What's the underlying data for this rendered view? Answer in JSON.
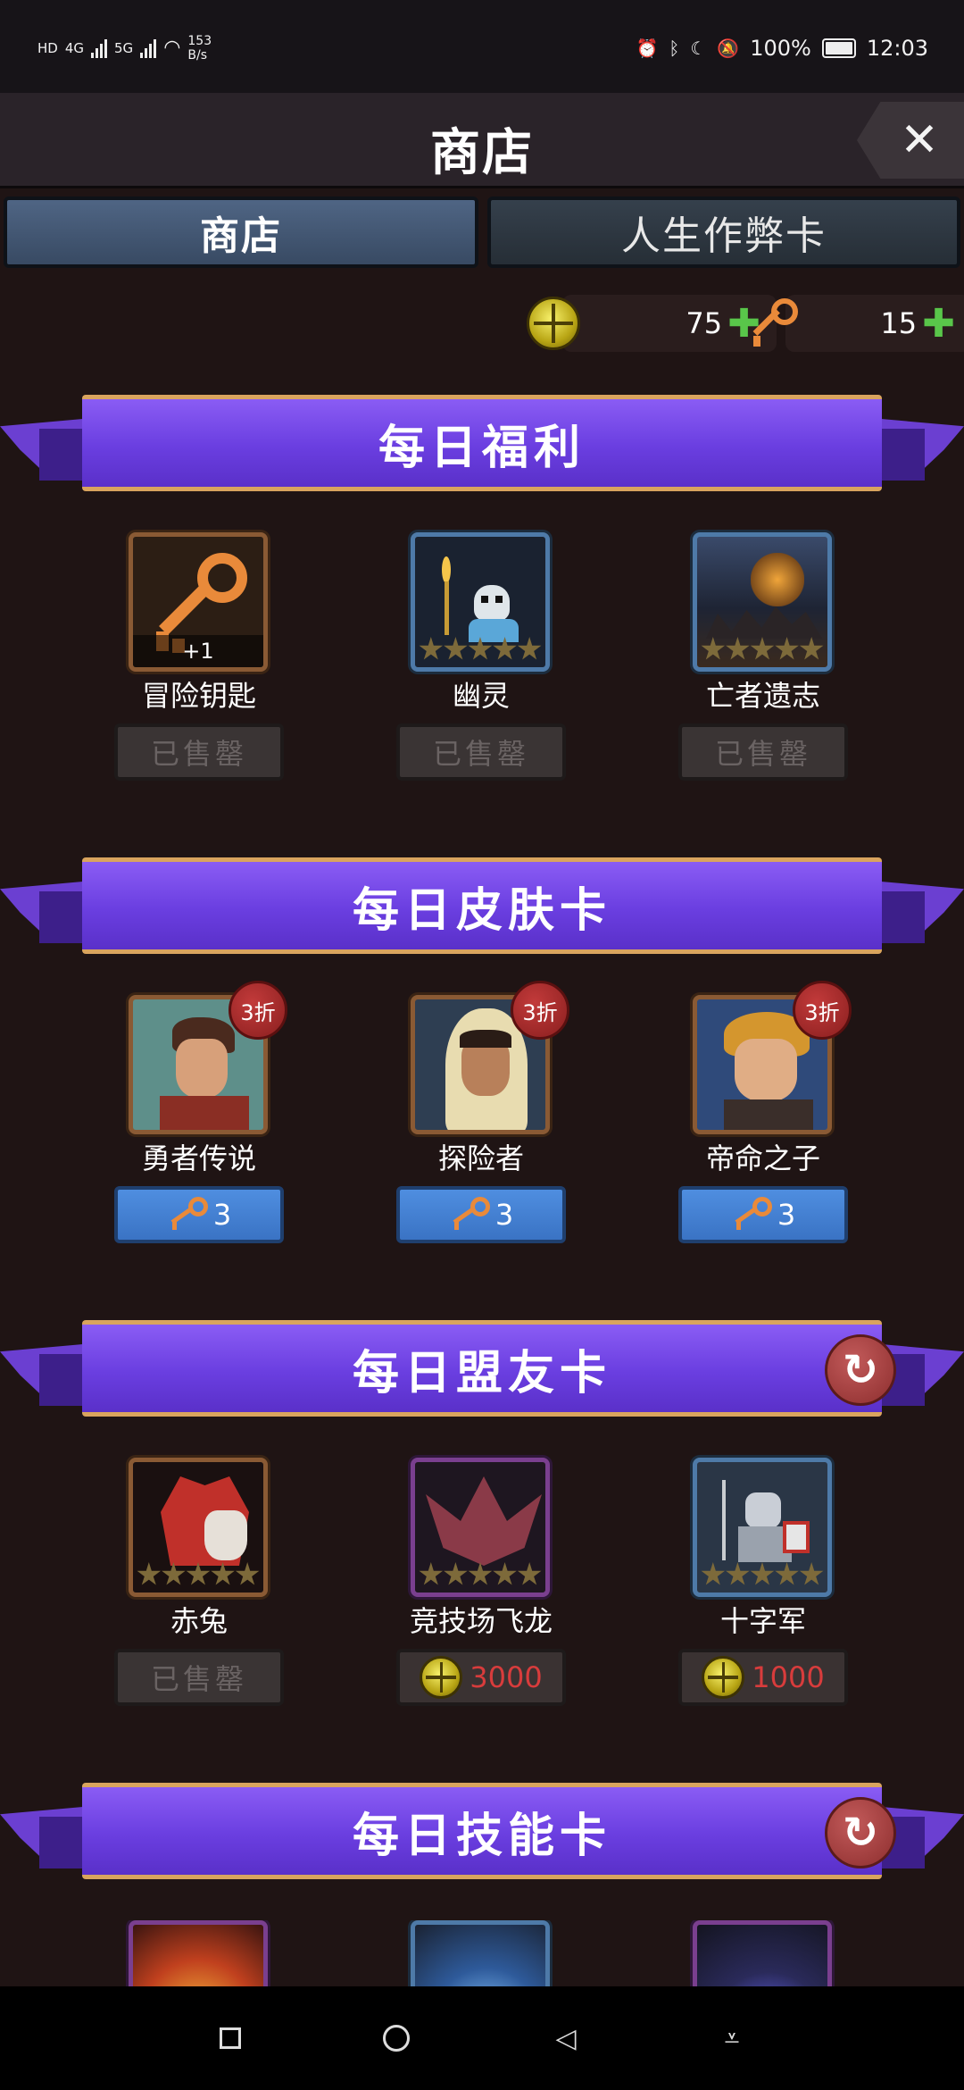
{
  "status_bar": {
    "network_left": "HD",
    "net_4g": "4G",
    "net_5g": "5G",
    "speed": "153",
    "speed_unit": "B/s",
    "battery": "100%",
    "time": "12:03"
  },
  "header": {
    "title": "商店",
    "close_icon": "close-icon"
  },
  "tabs": [
    {
      "label": "商店",
      "active": true
    },
    {
      "label": "人生作弊卡",
      "active": false
    }
  ],
  "currency": {
    "emblem_count": "75",
    "key_count": "15"
  },
  "sections": [
    {
      "title": "每日福利",
      "has_refresh": false,
      "items": [
        {
          "name": "冒险钥匙",
          "badge": "+1",
          "button": "已售罄",
          "button_type": "sold"
        },
        {
          "name": "幽灵",
          "button": "已售罄",
          "button_type": "sold"
        },
        {
          "name": "亡者遗志",
          "button": "已售罄",
          "button_type": "sold"
        }
      ]
    },
    {
      "title": "每日皮肤卡",
      "has_refresh": false,
      "items": [
        {
          "name": "勇者传说",
          "discount": "3折",
          "price": "3",
          "button_type": "key"
        },
        {
          "name": "探险者",
          "discount": "3折",
          "price": "3",
          "button_type": "key"
        },
        {
          "name": "帝命之子",
          "discount": "3折",
          "price": "3",
          "button_type": "key"
        }
      ]
    },
    {
      "title": "每日盟友卡",
      "has_refresh": true,
      "items": [
        {
          "name": "赤兔",
          "button": "已售罄",
          "button_type": "sold"
        },
        {
          "name": "竞技场飞龙",
          "price": "3000",
          "button_type": "emblem"
        },
        {
          "name": "十字军",
          "price": "1000",
          "button_type": "emblem"
        }
      ]
    },
    {
      "title": "每日技能卡",
      "has_refresh": true,
      "items": []
    }
  ],
  "colors": {
    "banner": "#6a3ee0",
    "banner_trim": "#d9a45e",
    "sold_text": "#6a6363",
    "price_red": "#d83c3c",
    "tab_active": "#4f6584"
  }
}
